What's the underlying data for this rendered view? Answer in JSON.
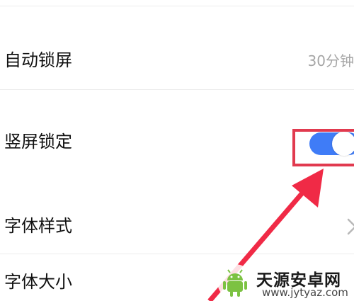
{
  "settings": {
    "auto_lock": {
      "label": "自动锁屏",
      "value": "30分钟"
    },
    "portrait_lock": {
      "label": "竖屏锁定",
      "enabled": true
    },
    "font_style": {
      "label": "字体样式"
    },
    "font_size": {
      "label": "字体大小"
    }
  },
  "annotation": {
    "highlight_color": "#e13a4f",
    "arrow_color": "#f02a46"
  },
  "toggle_color": "#3f7cf7",
  "watermark": {
    "title": "天源安卓网",
    "url": "www.jytyaz.com"
  }
}
